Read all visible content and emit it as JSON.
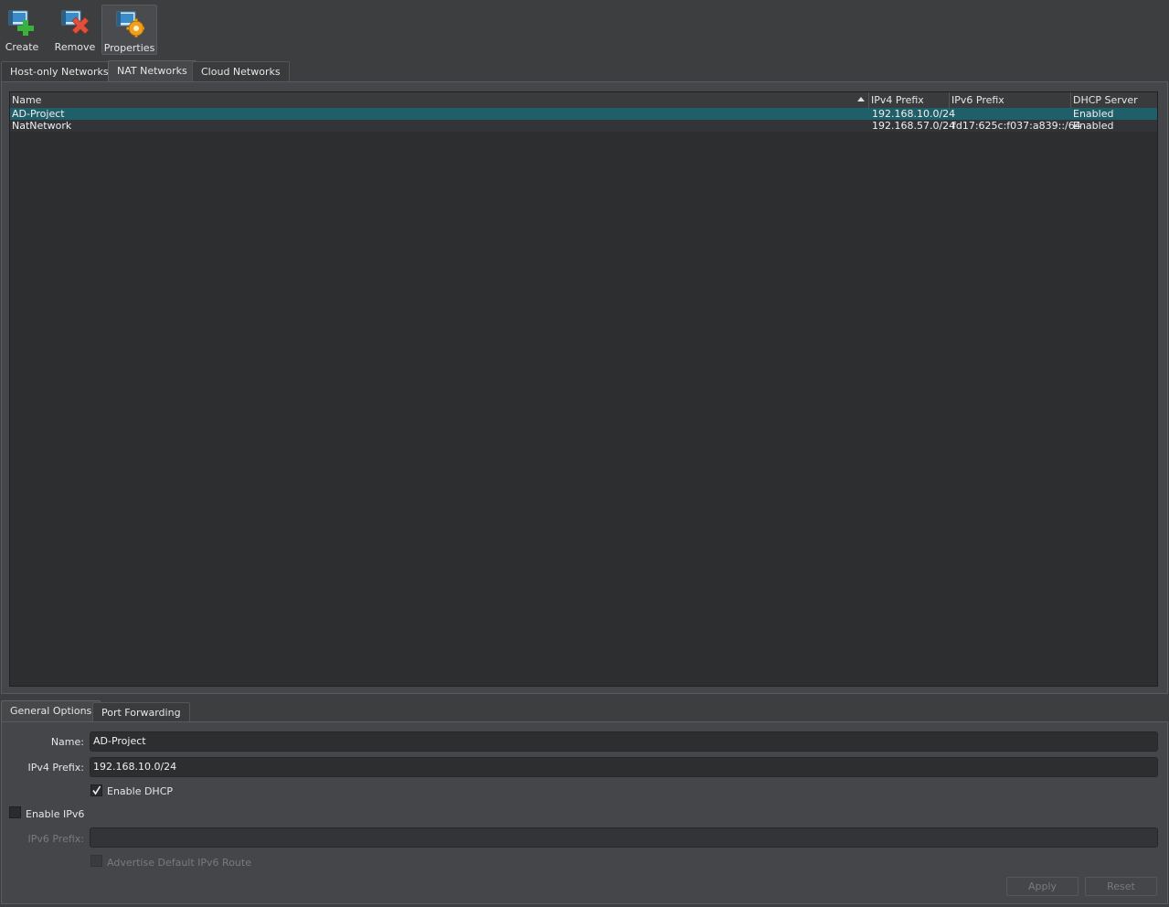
{
  "toolbar": {
    "create_label": "Create",
    "remove_label": "Remove",
    "properties_label": "Properties"
  },
  "top_tabs": [
    {
      "label": "Host-only Networks"
    },
    {
      "label": "NAT Networks",
      "selected": true
    },
    {
      "label": "Cloud Networks"
    }
  ],
  "table": {
    "columns": [
      "Name",
      "IPv4 Prefix",
      "IPv6 Prefix",
      "DHCP Server"
    ],
    "sort_column": "Name",
    "rows": [
      {
        "name": "AD-Project",
        "ipv4": "192.168.10.0/24",
        "ipv6": "",
        "dhcp": "Enabled",
        "selected": true
      },
      {
        "name": "NatNetwork",
        "ipv4": "192.168.57.0/24",
        "ipv6": "fd17:625c:f037:a839::/64",
        "dhcp": "Enabled"
      }
    ]
  },
  "detail_tabs": [
    {
      "label": "General Options",
      "selected": true
    },
    {
      "label": "Port Forwarding"
    }
  ],
  "form": {
    "name_label": "Name:",
    "name_value": "AD-Project",
    "ipv4_label": "IPv4 Prefix:",
    "ipv4_value": "192.168.10.0/24",
    "enable_dhcp_label": "Enable DHCP",
    "enable_dhcp_checked": true,
    "enable_ipv6_label": "Enable IPv6",
    "enable_ipv6_checked": false,
    "ipv6_label": "IPv6 Prefix:",
    "ipv6_value": "",
    "advertise_label": "Advertise Default IPv6 Route",
    "advertise_checked": false
  },
  "buttons": {
    "apply_label": "Apply",
    "reset_label": "Reset"
  },
  "colors": {
    "background": "#3d3e40",
    "selection": "#1f5f6a",
    "table_bg": "#2d2e30"
  }
}
